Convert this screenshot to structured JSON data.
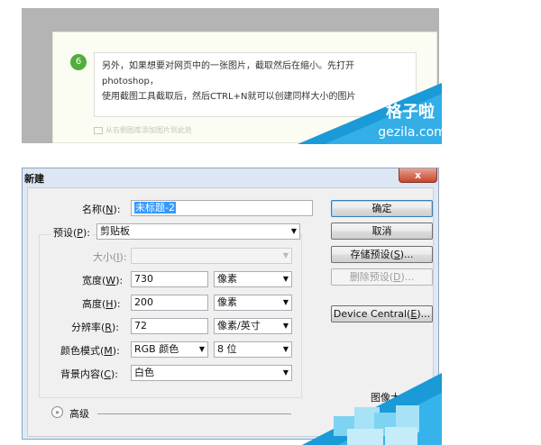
{
  "tip": {
    "step_number": "6",
    "line1": "另外，如果想要对网页中的一张图片，截取然后在缩小。先打开photoshop，",
    "line2": "使用截图工具截取后，然后CTRL+N就可以创建同样大小的图片",
    "footer": "从右侧图库添加图片到此处"
  },
  "watermark": {
    "text": "格子啦",
    "domain": "gezila.com",
    "color": "#1a9ad6"
  },
  "dialog": {
    "title": "新建",
    "close_label": "x",
    "name": {
      "label": "名称(",
      "key": "N",
      "suffix": "):",
      "value": "未标题-2"
    },
    "preset": {
      "label": "预设(",
      "key": "P",
      "suffix": "):",
      "value": "剪贴板"
    },
    "size": {
      "label": "大小(",
      "key": "I",
      "suffix": "):",
      "value": ""
    },
    "width": {
      "label": "宽度(",
      "key": "W",
      "suffix": "):",
      "value": "730",
      "unit": "像素"
    },
    "height": {
      "label": "高度(",
      "key": "H",
      "suffix": "):",
      "value": "200",
      "unit": "像素"
    },
    "resolution": {
      "label": "分辨率(",
      "key": "R",
      "suffix": "):",
      "value": "72",
      "unit": "像素/英寸"
    },
    "color_mode": {
      "label": "颜色模式(",
      "key": "M",
      "suffix": "):",
      "value": "RGB 颜色",
      "depth": "8 位"
    },
    "background": {
      "label": "背景内容(",
      "key": "C",
      "suffix": "):",
      "value": "白色"
    },
    "advanced": {
      "label": "高级",
      "toggle": "»"
    },
    "buttons": {
      "ok": "确定",
      "cancel": "取消",
      "save_preset": {
        "text": "存储预设(",
        "key": "S",
        "suffix": ")..."
      },
      "delete_preset": {
        "text": "删除预设(",
        "key": "D",
        "suffix": ")..."
      },
      "device_central": {
        "text": "Device Central(",
        "key": "E",
        "suffix": ")..."
      }
    },
    "image_size_label": "图像大小:"
  }
}
